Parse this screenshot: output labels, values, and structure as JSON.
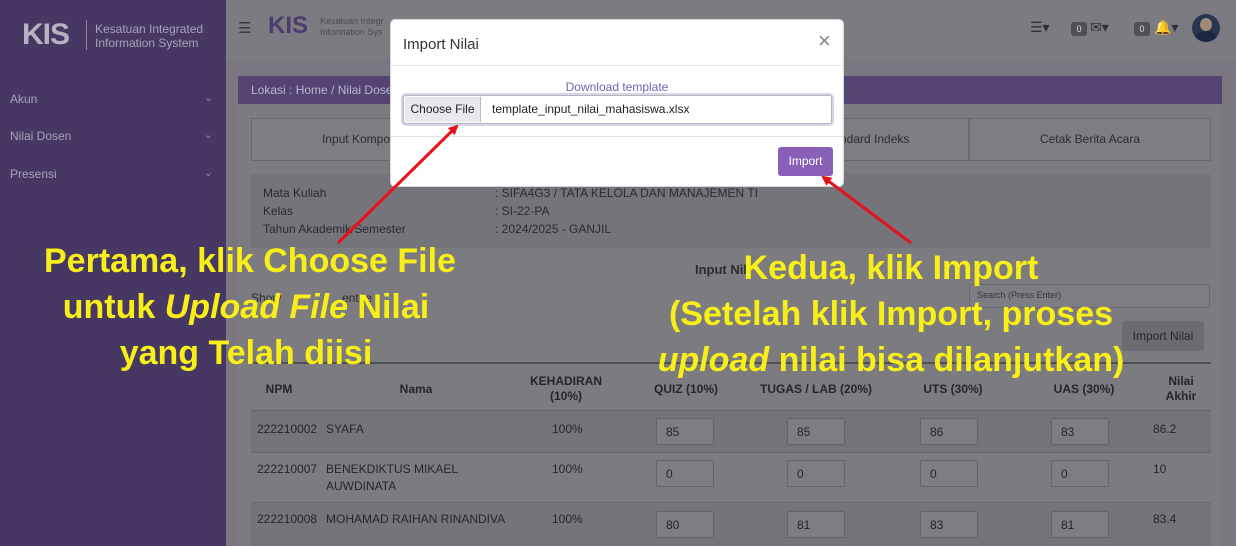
{
  "sidebar": {
    "logo": "KIS",
    "brand_line1": "Kesatuan Integrated",
    "brand_line2": "Information System",
    "items": [
      {
        "label": "Akun"
      },
      {
        "label": "Nilai Dosen"
      },
      {
        "label": "Presensi"
      }
    ]
  },
  "topbar": {
    "logo": "KIS",
    "brand_line1": "Kesatuan Integr",
    "brand_line2": "Information Sys",
    "messages_count": "0",
    "notifications_count": "0"
  },
  "breadcrumb": {
    "prefix": "Lokasi :",
    "home": "Home",
    "sep": "/",
    "current": "Nilai Dosen"
  },
  "tabs": [
    {
      "label": "Input Komponen d"
    },
    {
      "label": "ndard Indeks"
    },
    {
      "label": "Cetak Berita Acara"
    }
  ],
  "course_info": {
    "mk_label": "Mata Kuliah",
    "mk_value": ": SIFA4G3 / TATA KELOLA DAN MANAJEMEN TI",
    "kelas_label": "Kelas",
    "kelas_value": ": SI-22-PA",
    "ta_label": "Tahun Akademik/Semester",
    "ta_value": ": 2024/2025 - GANJIL"
  },
  "section_title": "Input Nil",
  "show_label": "Show",
  "entries_label": "entrie",
  "search_placeholder": "Search (Press Enter)",
  "import_button": "Import Nilai",
  "table": {
    "headers": {
      "npm": "NPM",
      "nama": "Nama",
      "kehadiran_1": "KEHADIRAN",
      "kehadiran_2": "(10%)",
      "quiz": "QUIZ (10%)",
      "tugas": "TUGAS / LAB (20%)",
      "uts": "UTS (30%)",
      "uas": "UAS (30%)",
      "nilai_1": "Nilai",
      "nilai_2": "Akhir"
    },
    "rows": [
      {
        "npm": "222210002",
        "nama": "SYAFA",
        "kehadiran": "100%",
        "quiz": "85",
        "tugas": "85",
        "uts": "86",
        "uas": "83",
        "akhir": "86.2"
      },
      {
        "npm": "222210007",
        "nama": "BENEKDIKTUS MIKAEL AUWDINATA",
        "kehadiran": "100%",
        "quiz": "0",
        "tugas": "0",
        "uts": "0",
        "uas": "0",
        "akhir": "10"
      },
      {
        "npm": "222210008",
        "nama": "MOHAMAD RAIHAN RINANDIVA",
        "kehadiran": "100%",
        "quiz": "80",
        "tugas": "81",
        "uts": "83",
        "uas": "81",
        "akhir": "83.4"
      }
    ]
  },
  "modal": {
    "title": "Import Nilai",
    "close": "×",
    "download_link": "Download template",
    "choose_file": "Choose File",
    "file_name": "template_input_nilai_mahasiswa.xlsx",
    "import": "Import"
  },
  "annotations": {
    "left_line1": "Pertama, klik Choose File",
    "left_line2_pre": "untuk ",
    "left_line2_em": "Upload File",
    "left_line2_post": " Nilai",
    "left_line3": "yang Telah diisi",
    "right_line1": "Kedua, klik Import",
    "right_line2": "(Setelah klik Import, proses",
    "right_line3_em": "upload",
    "right_line3_post": " nilai bisa dilanjutkan)"
  },
  "colors": {
    "sidebar": "#473863",
    "accent": "#8a5fb8",
    "annotation_text": "#f7ef17",
    "arrow": "#e8101a"
  }
}
